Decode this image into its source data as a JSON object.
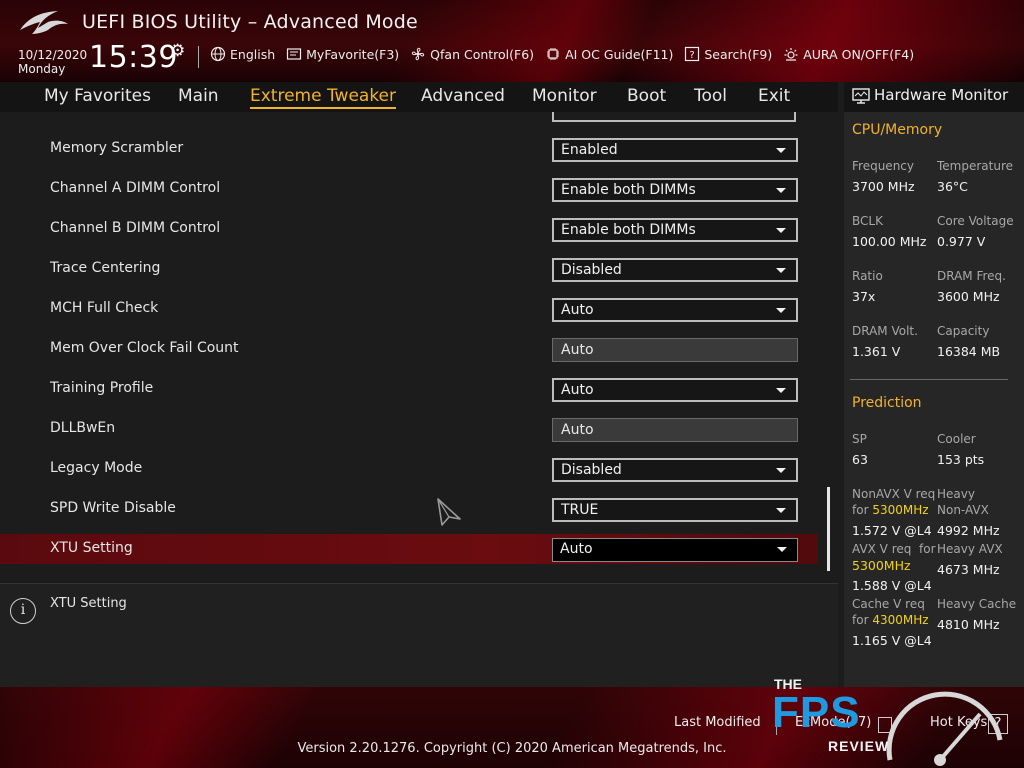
{
  "header": {
    "title": "UEFI BIOS Utility – Advanced Mode",
    "date": "10/12/2020",
    "day": "Monday",
    "time": "15:39",
    "toolbar": {
      "language": "English",
      "myfavorite": "MyFavorite(F3)",
      "qfan": "Qfan Control(F6)",
      "aioc": "AI OC Guide(F11)",
      "search": "Search(F9)",
      "aura": "AURA ON/OFF(F4)"
    }
  },
  "nav": {
    "tabs": [
      "My Favorites",
      "Main",
      "Extreme Tweaker",
      "Advanced",
      "Monitor",
      "Boot",
      "Tool",
      "Exit"
    ],
    "active": "Extreme Tweaker"
  },
  "settings": [
    {
      "label": "Memory Scrambler",
      "value": "Enabled"
    },
    {
      "label": "Channel A DIMM Control",
      "value": "Enable both DIMMs"
    },
    {
      "label": "Channel B DIMM Control",
      "value": "Enable both DIMMs"
    },
    {
      "label": "Trace Centering",
      "value": "Disabled"
    },
    {
      "label": "MCH Full Check",
      "value": "Auto"
    },
    {
      "label": "Mem Over Clock Fail Count",
      "value": "Auto"
    },
    {
      "label": "Training Profile",
      "value": "Auto"
    },
    {
      "label": "DLLBwEn",
      "value": "Auto"
    },
    {
      "label": "Legacy Mode",
      "value": "Disabled"
    },
    {
      "label": "SPD Write Disable",
      "value": "TRUE"
    },
    {
      "label": "XTU Setting",
      "value": "Auto"
    }
  ],
  "help": {
    "icon": "info-icon",
    "text": "XTU Setting"
  },
  "hardware_monitor": {
    "title": "Hardware Monitor",
    "cpu_memory": {
      "heading": "CPU/Memory",
      "frequency_label": "Frequency",
      "frequency": "3700 MHz",
      "temperature_label": "Temperature",
      "temperature": "36°C",
      "bclk_label": "BCLK",
      "bclk": "100.00 MHz",
      "core_voltage_label": "Core Voltage",
      "core_voltage": "0.977 V",
      "ratio_label": "Ratio",
      "ratio": "37x",
      "dram_freq_label": "DRAM Freq.",
      "dram_freq": "3600 MHz",
      "dram_volt_label": "DRAM Volt.",
      "dram_volt": "1.361 V",
      "capacity_label": "Capacity",
      "capacity": "16384 MB"
    },
    "prediction": {
      "heading": "Prediction",
      "sp_label": "SP",
      "sp": "63",
      "cooler_label": "Cooler",
      "cooler": "153 pts",
      "nonavx_req_label": "NonAVX V req",
      "for_word": "for",
      "nonavx_freq": "5300MHz",
      "nonavx_req": "1.572 V @L4",
      "heavy_label": "Heavy",
      "nonavx_label": "Non-AVX",
      "heavy_nonavx": "4992 MHz",
      "avx_req_label": "AVX V req",
      "avx_for_word": "for",
      "avx_freq": "5300MHz",
      "avx_req": "1.588 V @L4",
      "heavy_avx_label": "Heavy AVX",
      "heavy_avx": "4673 MHz",
      "cache_req_label": "Cache V req",
      "cache_for_word": "for",
      "cache_freq": "4300MHz",
      "cache_req": "1.165 V @L4",
      "heavy_cache_label": "Heavy Cache",
      "heavy_cache": "4810 MHz"
    }
  },
  "footer": {
    "last_modified": "Last Modified",
    "ezmode": "EzMode(F7)",
    "hotkeys": "Hot Keys",
    "hotkeys_key": "?",
    "version": "Version 2.20.1276. Copyright (C) 2020 American Megatrends, Inc."
  },
  "watermark": {
    "the": "THE",
    "fps": "FPS",
    "review": "REVIEW"
  },
  "colors": {
    "accent": "#f2b32a",
    "selected_row": "#6a0c10",
    "highlight_freq": "#f2d21a",
    "watermark_blue": "#1f9ae0"
  }
}
